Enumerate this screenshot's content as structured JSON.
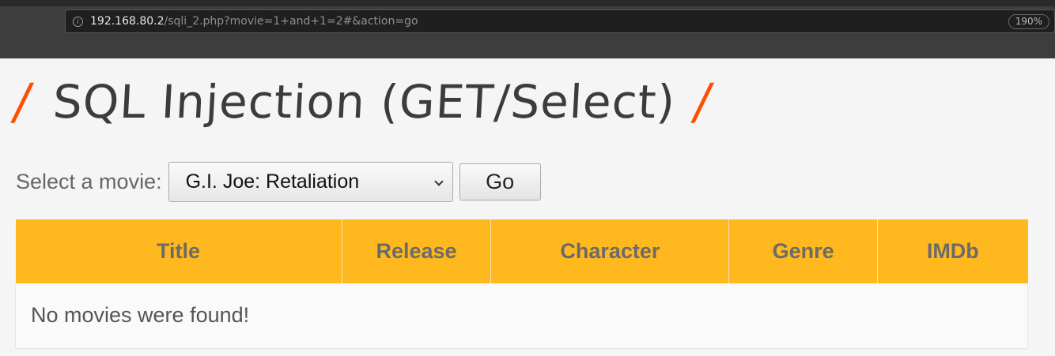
{
  "browser": {
    "url_host": "192.168.80.2",
    "url_path": "/sqli_2.php?movie=1+and+1=2#&action=go",
    "zoom": "190%"
  },
  "page": {
    "title": "SQL Injection (GET/Select)",
    "slash_left": "/",
    "slash_right": "/"
  },
  "form": {
    "label": "Select a movie:",
    "selected_movie": "G.I. Joe: Retaliation",
    "go_label": "Go"
  },
  "table": {
    "headers": [
      "Title",
      "Release",
      "Character",
      "Genre",
      "IMDb"
    ],
    "empty_message": "No movies were found!"
  },
  "colors": {
    "accent": "#ff4e00",
    "table_header": "#ffb81d"
  }
}
